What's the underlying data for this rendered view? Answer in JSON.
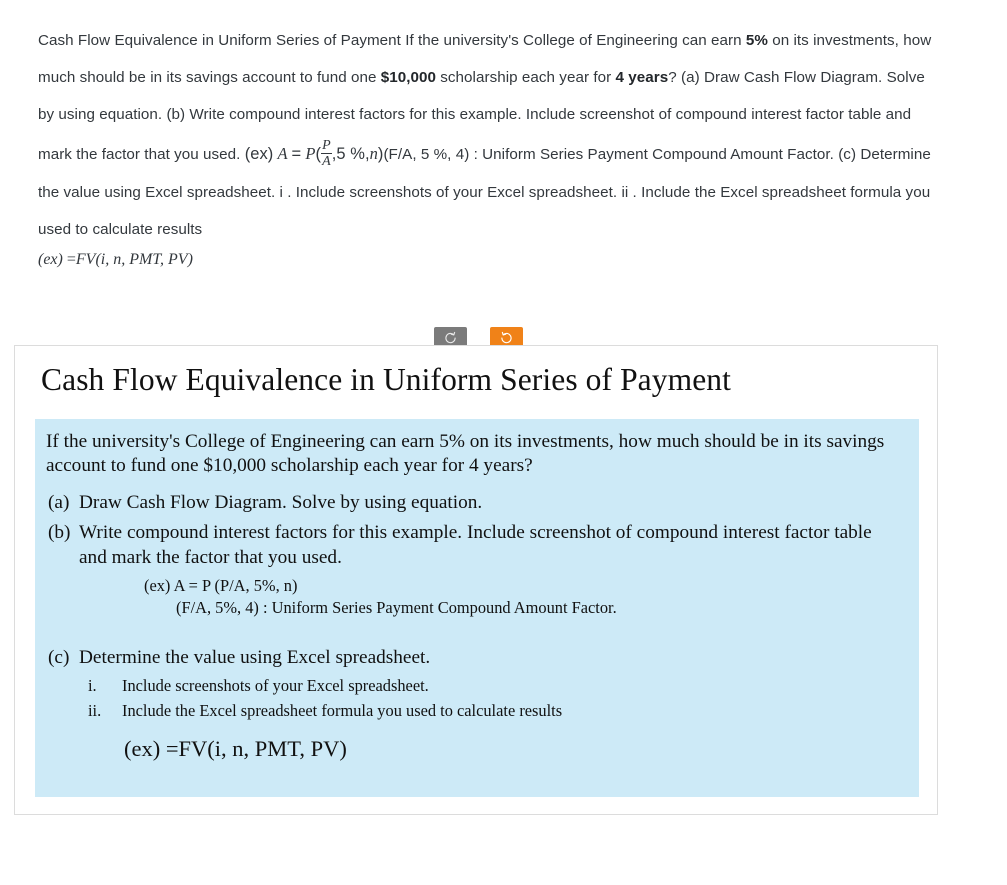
{
  "question_block": {
    "segments": [
      {
        "t": "Cash Flow Equivalence in Uniform Series of Payment If the university's College of Engineering can earn ",
        "bold": false
      },
      {
        "t": "5%",
        "bold": true
      },
      {
        "t": " on its investments, how much should be in its savings account to fund one ",
        "bold": false
      },
      {
        "t": "$10,000",
        "bold": true
      },
      {
        "t": " scholarship each year for ",
        "bold": false
      },
      {
        "t": "4 years",
        "bold": true
      },
      {
        "t": "? (a) Draw Cash Flow Diagram. Solve by using equation. (b) Write compound interest factors for this example. Include screenshot of compound interest factor table and mark the factor that you used. ",
        "bold": false
      }
    ],
    "plain_text": "Cash Flow Equivalence in Uniform Series of Payment If the university's College of Engineering can earn 5% on its investments, how much should be in its savings account to fund one $10,000 scholarship each year for 4 years? (a) Draw Cash Flow Diagram. Solve by using equation. (b) Write compound interest factors for this example. Include screenshot of compound interest factor table and mark the factor that you used. (ex) A = P(P/A, 5%, n) (F/A, 5%, 4) : Uniform Series Payment Compound Amount Factor. (c) Determine the value using Excel spreadsheet. i. Include screenshots of your Excel spreadsheet. ii. Include the Excel spreadsheet formula you used to calculate results (ex) = FV(i, n, PMT, PV)",
    "inline_formula": {
      "ex_label": "(ex)",
      "lhs": "A",
      "equals": "=",
      "p": "P",
      "open_paren": "(",
      "frac_num": "P",
      "frac_den": "A",
      "comma1": ",",
      "rate": "5 %",
      "comma2": ",",
      "n": "n",
      "close_paren": ")",
      "factor": "(F/A,  5 %,  4) :"
    },
    "tail_text": "Uniform Series Payment Compound Amount Factor. (c) Determine the value using Excel spreadsheet. i .  Include screenshots of your Excel spreadsheet. ii .  Include the Excel spreadsheet formula you used to calculate results",
    "final_formula": {
      "ex_label": "(ex)",
      "equals": "=",
      "fn": "FV",
      "args": "(i, n, PMT, PV)"
    }
  },
  "toolbar": {
    "undo_label": "Undo",
    "undo_icon": "rotate-ccw-icon",
    "redo_label": "Redo",
    "redo_icon": "rotate-cw-icon",
    "undo_color": "#7b7b7b",
    "redo_color": "#f08218"
  },
  "answer_card": {
    "title": "Cash Flow Equivalence in Uniform Series of Payment",
    "panel_bg": "#cdeaf7",
    "intro": "If the university's College of Engineering can earn 5% on its investments, how much should be in its savings account to fund one $10,000 scholarship each year for 4 years?",
    "items": [
      {
        "label": "(a)",
        "text": "Draw Cash Flow Diagram. Solve by using equation."
      },
      {
        "label": "(b)",
        "text": "Write compound interest factors for this example. Include screenshot of compound interest factor table and mark the factor that you used."
      }
    ],
    "ex_line_1": "(ex) A = P (P/A, 5%, n)",
    "ex_line_2": "(F/A, 5%, 4) : Uniform Series Payment Compound Amount Factor.",
    "item_c": {
      "label": "(c)",
      "text": "Determine the value using Excel spreadsheet."
    },
    "roman_items": [
      {
        "num": "i.",
        "text": "Include screenshots of your Excel spreadsheet."
      },
      {
        "num": "ii.",
        "text": "Include the Excel spreadsheet formula you used to calculate results"
      }
    ],
    "final_formula": "(ex) =FV(i, n, PMT, PV)"
  }
}
